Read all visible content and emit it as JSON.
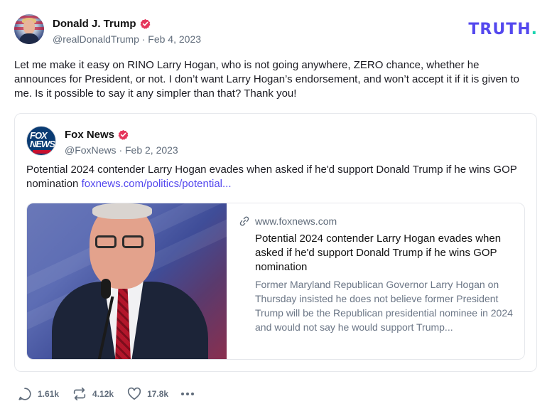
{
  "post": {
    "author_name": "Donald J. Trump",
    "meta": "@realDonaldTrump · Feb 4, 2023",
    "logo": "TRUTH",
    "logo_dot": ".",
    "body": "Let me make it easy on RINO Larry Hogan, who is not going anywhere, ZERO chance, whether he announces for President, or not. I don’t want Larry Hogan’s endorsement, and won’t accept it if it is given to me. Is it possible to say it any simpler than that? Thank you!"
  },
  "quote": {
    "author_name": "Fox News",
    "avatar_text": "FOX NEWS",
    "meta": "@FoxNews · Feb 2, 2023",
    "body": "Potential 2024 contender Larry Hogan evades when asked if he'd support Donald Trump if he wins GOP nomination",
    "link": "foxnews.com/politics/potential..."
  },
  "card": {
    "domain": "www.foxnews.com",
    "title": "Potential 2024 contender Larry Hogan evades when asked if he'd support Donald Trump if he wins GOP nomination",
    "description": "Former Maryland Republican Governor Larry Hogan on Thursday insisted he does not believe former President Trump will be the Republican presidential nominee in 2024 and would not say he would support Trump..."
  },
  "actions": {
    "replies": "1.61k",
    "retruths": "4.12k",
    "likes": "17.8k"
  },
  "colors": {
    "brand": "#5448ee",
    "verified": "#e5355b",
    "logo_dot": "#1bd5b0"
  }
}
